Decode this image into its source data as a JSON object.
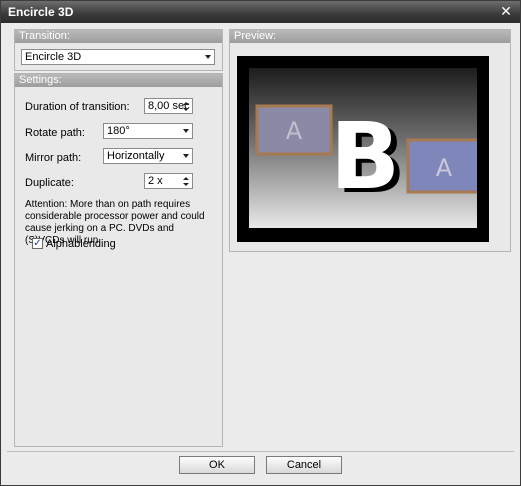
{
  "window": {
    "title": "Encircle 3D"
  },
  "transition": {
    "header": "Transition:",
    "selected": "Encircle 3D"
  },
  "settings": {
    "header": "Settings:",
    "duration": {
      "label": "Duration of transition:",
      "value": "8,00 sec"
    },
    "rotate": {
      "label": "Rotate path:",
      "value": "180°"
    },
    "mirror": {
      "label": "Mirror path:",
      "value": "Horizontally"
    },
    "duplicate": {
      "label": "Duplicate:",
      "value": "2 x"
    },
    "attention": "Attention: More than on path requires considerable processor power and could cause jerking on a PC. DVDs and (S)VCDs will run",
    "alphablending": {
      "label": "Alphablending",
      "checked": true
    }
  },
  "preview": {
    "header": "Preview:",
    "letter_a": "A",
    "letter_b": "B"
  },
  "buttons": {
    "ok": "OK",
    "cancel": "Cancel"
  }
}
